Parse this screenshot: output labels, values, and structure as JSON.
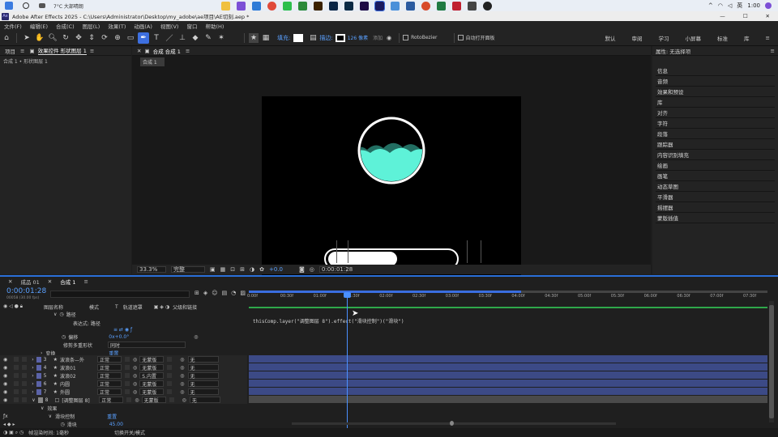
{
  "taskbar": {
    "weather": "7°C 大部晴朗",
    "lang": "英",
    "time": "1:00"
  },
  "titlebar": {
    "logo": "Ae",
    "title": "Adobe After Effects 2025 - C:\\Users\\Administrator\\Desktop\\my_adobe\\ae项目\\AE切刻.aep *"
  },
  "menu": [
    "文件(F)",
    "编辑(E)",
    "合成(C)",
    "图层(L)",
    "效果(T)",
    "动画(A)",
    "视图(V)",
    "窗口",
    "帮助(H)"
  ],
  "toolbar": {
    "fill_label": "填充:",
    "stroke_label": "描边:",
    "stroke_width": "126 像素",
    "add_label": "添加",
    "rotobezier": "RotoBezier",
    "auto_open": "自动打开面板",
    "workspaces": [
      "默认",
      "审阅",
      "学习",
      "小屏幕",
      "标准",
      "库"
    ]
  },
  "project_panel": {
    "tab_project": "项目",
    "tab_effects": "效果控件 形状图层 1",
    "breadcrumb": "合成 1 • 形状图层 1"
  },
  "comp_panel": {
    "tab": "合成 合成 1",
    "subtab": "合成 1",
    "zoom": "33.3%",
    "quality": "完整",
    "exposure": "+0.0",
    "timecode": "0:00:01:28"
  },
  "right_panel": {
    "title": "属性: 无选择项",
    "items": [
      "信息",
      "音频",
      "效果和预设",
      "库",
      "对齐",
      "字符",
      "段落",
      "跟踪器",
      "内容识别填充",
      "绘画",
      "画笔",
      "动态草图",
      "平滑器",
      "摇摆器",
      "蒙版插值"
    ]
  },
  "timeline": {
    "tab1": "成品 01",
    "tab2": "合成 1",
    "timecode": "0:00:01:28",
    "fps": "00058 (30.00 fps)",
    "col_layer_name": "图层名称",
    "col_mode": "模式",
    "col_t": "T",
    "col_track": "轨道遮罩",
    "col_parent": "父级和链接",
    "ruler": [
      "0:00f",
      "00:30f",
      "01:00f",
      "01:30f",
      "02:00f",
      "02:30f",
      "03:00f",
      "03:30f",
      "04:00f",
      "04:30f",
      "05:00f",
      "05:30f",
      "06:00f",
      "06:30f",
      "07:00f",
      "07:30f"
    ],
    "prop_path": "路径",
    "prop_path_val": "",
    "prop_expr": "表达式: 路径",
    "prop_offset": "偏移",
    "prop_offset_val": "0x+0.0°",
    "prop_trim": "修剪多重形状",
    "prop_trim_val": "同时",
    "prop_transform": "变换",
    "prop_transform_val": "重置",
    "expression": "thisComp.layer(\"调整图层 8\").effect(\"滑块控制\")(\"滑块\")",
    "layers": [
      {
        "num": "3",
        "name": "波浪条—外",
        "mode": "正常",
        "track": "无蒙版",
        "parent": "无",
        "color": "#5b63a8"
      },
      {
        "num": "4",
        "name": "波浪01",
        "mode": "正常",
        "track": "无蒙版",
        "parent": "无",
        "color": "#5b63a8"
      },
      {
        "num": "5",
        "name": "波浪02",
        "mode": "正常",
        "track": "S.内置",
        "parent": "无",
        "color": "#5b63a8"
      },
      {
        "num": "6",
        "name": "内圆",
        "mode": "正常",
        "track": "无蒙版",
        "parent": "无",
        "color": "#5b63a8"
      },
      {
        "num": "7",
        "name": "外圆",
        "mode": "正常",
        "track": "无蒙版",
        "parent": "无",
        "color": "#5b63a8"
      },
      {
        "num": "8",
        "name": "[调整图层 8]",
        "mode": "正常",
        "track": "无蒙版",
        "parent": "无",
        "color": "#888888"
      }
    ],
    "effects_label": "效果",
    "slider_ctrl": "滑块控制",
    "slider_reset": "重置",
    "slider_prop": "滑块",
    "slider_val": "45.00",
    "footer_left": "帧渲染时间: 1毫秒",
    "footer_mid": "切换开关/模式"
  }
}
